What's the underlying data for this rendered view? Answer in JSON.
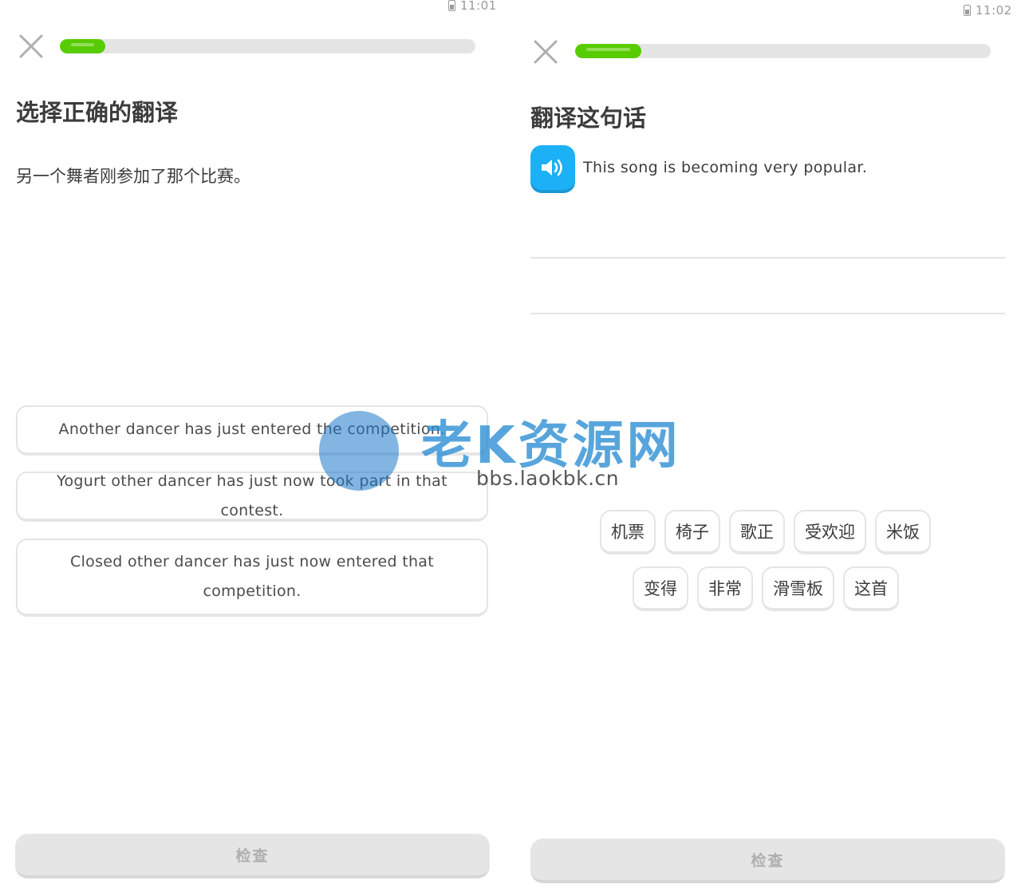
{
  "left_screen": {
    "status_time": "11:01",
    "progress": 0.11,
    "heading": "选择正确的翻译",
    "prompt": "另一个舞者刚参加了那个比赛。",
    "options": [
      "Another dancer has just entered the competition.",
      "Yogurt other dancer has just now took part in that contest.",
      "Closed other dancer has just now entered that competition."
    ],
    "check_label": "检查"
  },
  "right_screen": {
    "status_time": "11:02",
    "progress": 0.16,
    "heading": "翻译这句话",
    "sentence": "This song is becoming very popular.",
    "word_bank_row1": [
      "机票",
      "椅子",
      "歌正",
      "受欢迎",
      "米饭"
    ],
    "word_bank_row2": [
      "变得",
      "非常",
      "滑雪板",
      "这首"
    ],
    "check_label": "检查"
  },
  "watermark": {
    "title": "老K资源网",
    "url": "bbs.laokbk.cn"
  },
  "colors": {
    "progress_green": "#58cc02",
    "speaker_blue": "#1cb0f6",
    "border_gray": "#e5e5e5",
    "disabled_text": "#afafaf"
  },
  "icons": {
    "close": "close-icon",
    "speaker": "speaker-icon",
    "battery": "battery-icon"
  }
}
